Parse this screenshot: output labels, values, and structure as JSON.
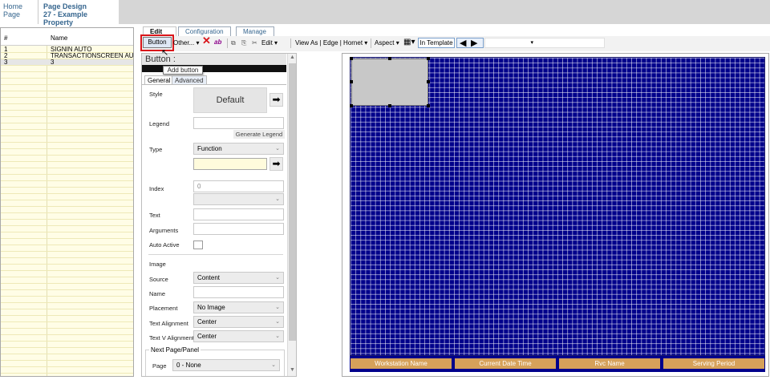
{
  "breadcrumb": {
    "home_line1": "Home",
    "home_line2": "Page",
    "page_line1": "Page Design",
    "page_line2": "27 - Example Property"
  },
  "page_list": {
    "headers": {
      "num": "#",
      "name": "Name"
    },
    "rows": [
      {
        "num": "1",
        "name": "SIGNIN AUTO"
      },
      {
        "num": "2",
        "name": "TRANSACTIONSCREEN AU..."
      },
      {
        "num": "3",
        "name": "3"
      }
    ]
  },
  "tabs": {
    "edit": "Edit",
    "configuration": "Configuration",
    "manage": "Manage"
  },
  "toolbar": {
    "button": "Button",
    "other": "Other...",
    "delete_icon": "red-x-delete-icon",
    "text_icon_label": "ab",
    "edit": "Edit",
    "view_as": "View As | Edge | Hornet",
    "aspect": "Aspect",
    "in_template": "In Template",
    "combo_value": "",
    "tooltip": "Add button"
  },
  "properties": {
    "title": "Button :",
    "tab_general": "General",
    "tab_advanced": "Advanced",
    "style_label": "Style",
    "style_value": "Default",
    "legend_label": "Legend",
    "legend_value": "",
    "generate_legend": "Generate Legend",
    "type_label": "Type",
    "type_value": "Function",
    "type_input": "",
    "index_label": "Index",
    "index_value": "0",
    "index_select": "",
    "text_label": "Text",
    "text_value": "",
    "arguments_label": "Arguments",
    "arguments_value": "",
    "auto_active_label": "Auto Active",
    "auto_active_checked": false,
    "image_section": "Image",
    "source_label": "Source",
    "source_value": "Content",
    "name_label": "Name",
    "name_value": "",
    "placement_label": "Placement",
    "placement_value": "No Image",
    "text_alignment_label": "Text Alignment",
    "text_alignment_value": "Center",
    "text_v_alignment_label": "Text V Alignment",
    "text_v_alignment_value": "Center",
    "next_page_panel": "Next Page/Panel",
    "page_label": "Page",
    "page_value": "0 - None"
  },
  "status_bar": [
    "Workstation Name",
    "Current Date Time",
    "Rvc Name",
    "Serving Period"
  ],
  "colors": {
    "canvas": "#00008b",
    "status": "#d6a15a",
    "highlight": "#d9151a",
    "link": "#35658e"
  }
}
